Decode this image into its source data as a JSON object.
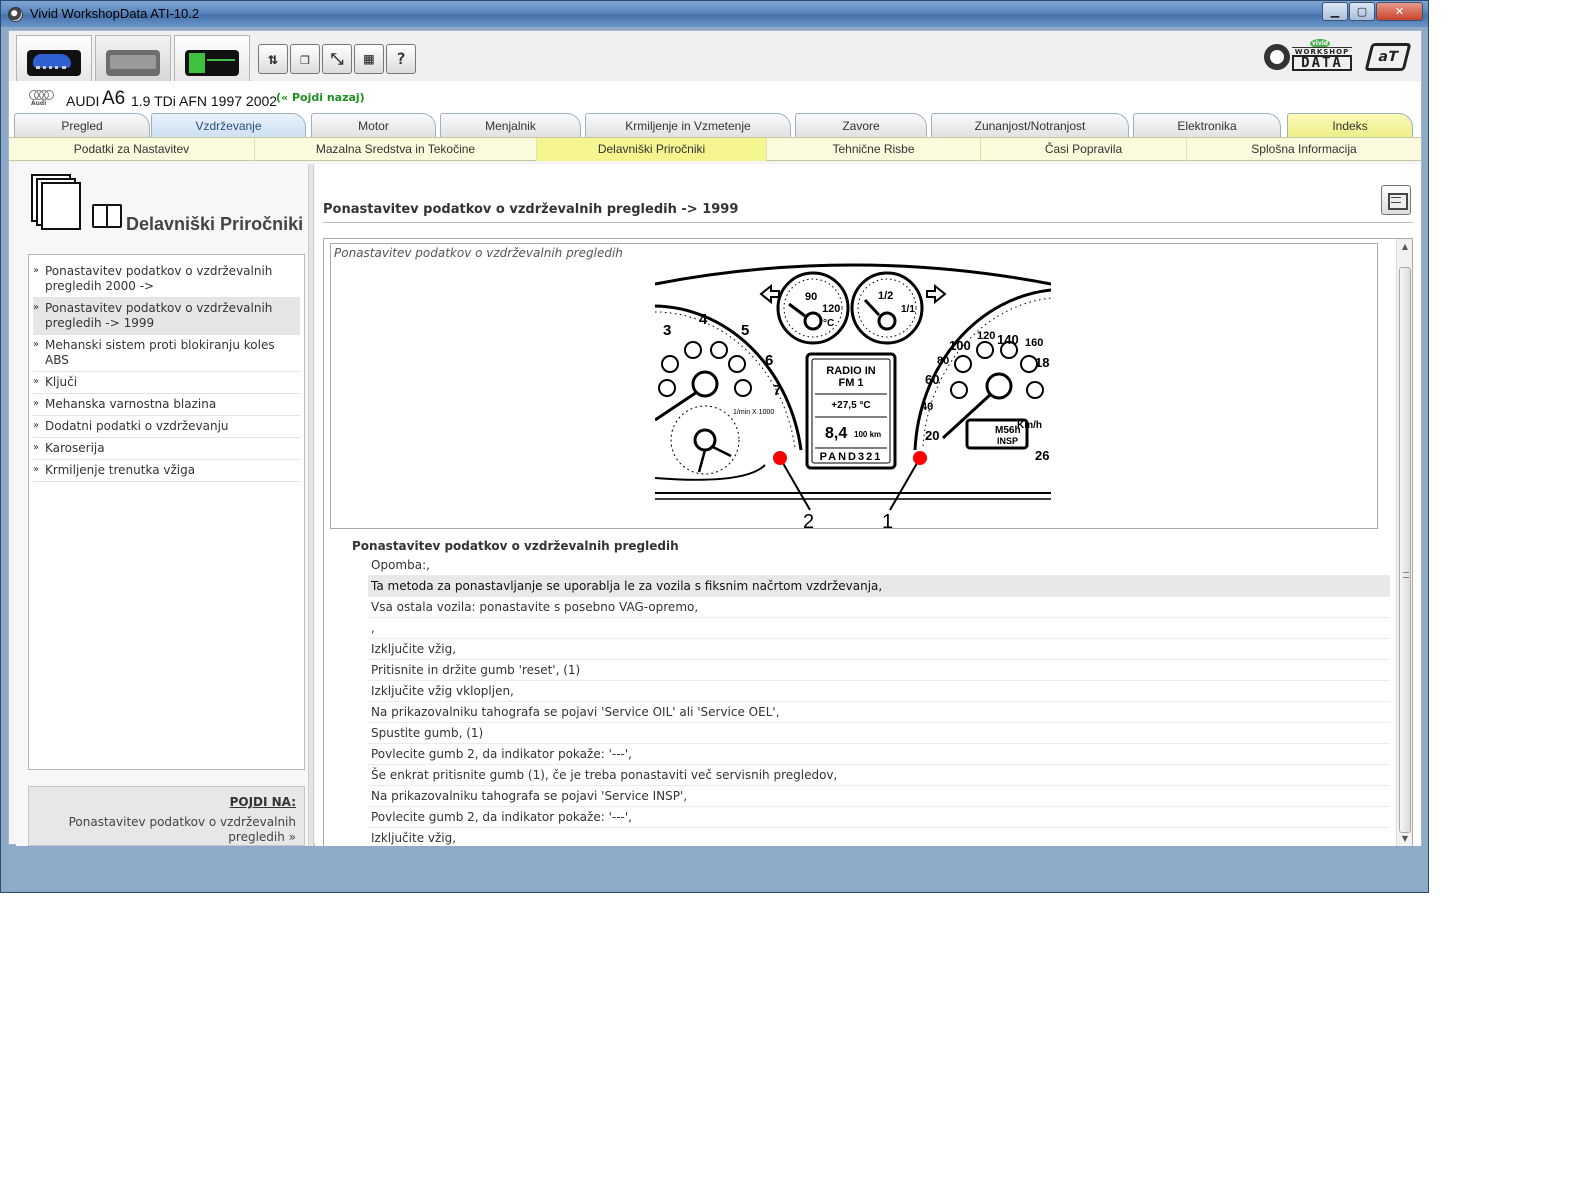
{
  "window": {
    "title": "Vivid WorkshopData ATI-10.2"
  },
  "toolbar": {
    "modes": [
      "car-mode",
      "truck-mode",
      "ecu-mode"
    ],
    "tools": [
      "book-tool",
      "copy-tool",
      "ruler-tool",
      "calculator-tool",
      "help-tool"
    ],
    "tool_glyphs": [
      "⇅",
      "❐",
      "⤡",
      "▦",
      "?"
    ],
    "logo_small": "vivid",
    "logo_top": "WORKSHOP",
    "logo_main": "DATA",
    "logo_ati": "aT"
  },
  "vehicle": {
    "brand_word": "Audi",
    "make": "AUDI",
    "model": "A6",
    "engine": "1.9 TDi AFN 1997 2002",
    "back_link": "(« Pojdi nazaj)"
  },
  "main_tabs": [
    {
      "label": "Pregled"
    },
    {
      "label": "Vzdrževanje"
    },
    {
      "label": "Motor"
    },
    {
      "label": "Menjalnik"
    },
    {
      "label": "Krmiljenje in Vzmetenje"
    },
    {
      "label": "Zavore"
    },
    {
      "label": "Zunanjost/Notranjost"
    },
    {
      "label": "Elektronika"
    },
    {
      "label": "Indeks"
    }
  ],
  "sub_tabs": [
    {
      "label": "Podatki za Nastavitev"
    },
    {
      "label": "Mazalna Sredstva in Tekočine"
    },
    {
      "label": "Delavniški Priročniki"
    },
    {
      "label": "Tehnične Risbe"
    },
    {
      "label": "Časi Popravila"
    },
    {
      "label": "Splošna Informacija"
    }
  ],
  "sidebar": {
    "title": "Delavniški Priročniki",
    "items": [
      {
        "label": "Ponastavitev podatkov o vzdrževalnih pregledih 2000 ->"
      },
      {
        "label": "Ponastavitev podatkov o vzdrževalnih pregledih -> 1999"
      },
      {
        "label": "Mehanski sistem proti blokiranju koles ABS"
      },
      {
        "label": "Ključi"
      },
      {
        "label": "Mehanska varnostna blazina"
      },
      {
        "label": "Dodatni podatki o vzdrževanju"
      },
      {
        "label": "Karoserija"
      },
      {
        "label": "Krmiljenje trenutka vžiga"
      }
    ],
    "bullet": "»",
    "goto_title": "POJDI NA:",
    "goto_link": "Ponastavitev podatkov o vzdrževalnih pregledih »"
  },
  "content": {
    "heading": "Ponastavitev podatkov o vzdrževalnih pregledih -> 1999",
    "figure_caption": "Ponastavitev podatkov o vzdrževalnih pregledih",
    "section_heading": "Ponastavitev podatkov o vzdrževalnih pregledih",
    "steps": [
      "Opomba:,",
      "Ta metoda za ponastavljanje se uporablja le za vozila s fiksnim načrtom vzdrževanja,",
      "Vsa ostala vozila: ponastavite s posebno VAG-opremo,",
      " ,",
      "Izključite vžig,",
      "Pritisnite in držite gumb 'reset', (1)",
      "Izključite vžig vklopljen,",
      "Na prikazovalniku tahografa se pojavi 'Service OIL' ali 'Service OEL',",
      "Spustite gumb, (1)",
      "Povlecite gumb 2, da indikator pokaže: '---',",
      "Še enkrat pritisnite gumb (1), če je treba ponastaviti več servisnih pregledov,",
      "Na prikazovalniku tahografa se pojavi 'Service INSP',",
      "Povlecite gumb 2, da indikator pokaže: '---',",
      "Izključite vžig,"
    ]
  },
  "dashboard": {
    "tacho_labels": [
      "3",
      "4",
      "5",
      "6",
      "7"
    ],
    "tacho_unit": "1/min X 1000",
    "temp_labels": [
      "90",
      "120"
    ],
    "temp_unit": "°C",
    "fuel_labels": [
      "1/2",
      "1/1"
    ],
    "speed_labels": [
      "20",
      "40",
      "60",
      "80",
      "100",
      "120",
      "140",
      "160",
      "18",
      "26"
    ],
    "speed_unit": "Km/h",
    "display_lines": [
      "RADIO IN",
      "FM 1",
      "+27,5 °C",
      "8,4",
      "100 km",
      "PAND321"
    ],
    "odo_lines": [
      "M56h",
      "INSP"
    ],
    "callouts": [
      "2",
      "1"
    ],
    "callout_color": "#ff0000"
  }
}
